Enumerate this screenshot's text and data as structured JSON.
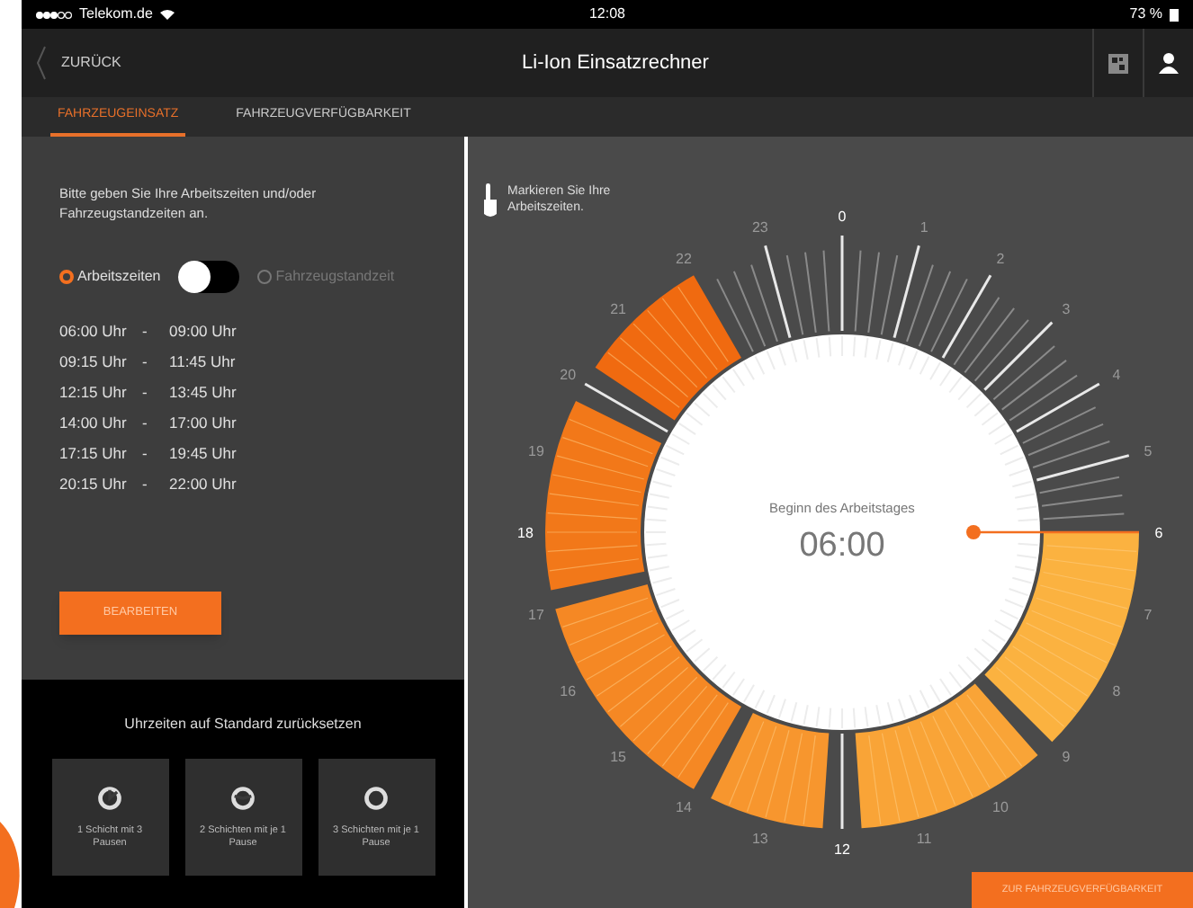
{
  "status_bar": {
    "carrier": "Telekom.de",
    "time": "12:08",
    "battery": "73 %"
  },
  "nav": {
    "back": "ZURÜCK",
    "title": "Li-Ion Einsatzrechner"
  },
  "tabs": [
    {
      "label": "FAHRZEUGEINSATZ",
      "selected": true
    },
    {
      "label": "FAHRZEUGVERFÜGBARKEIT",
      "selected": false
    }
  ],
  "left": {
    "instructions": "Bitte geben Sie Ihre Arbeitszeiten und/oder Fahrzeugstandzeiten an.",
    "modes": [
      {
        "label": "Arbeitszeiten",
        "selected": true
      },
      {
        "label": "Fahrzeugstandzeit",
        "selected": false
      }
    ],
    "toggle_on": false,
    "times": [
      {
        "start": "06:00 Uhr",
        "sep": "-",
        "end": "09:00 Uhr"
      },
      {
        "start": "09:15 Uhr",
        "sep": "-",
        "end": "11:45 Uhr"
      },
      {
        "start": "12:15 Uhr",
        "sep": "-",
        "end": "13:45 Uhr"
      },
      {
        "start": "14:00 Uhr",
        "sep": "-",
        "end": "17:00 Uhr"
      },
      {
        "start": "17:15 Uhr",
        "sep": "-",
        "end": "19:45 Uhr"
      },
      {
        "start": "20:15 Uhr",
        "sep": "-",
        "end": "22:00 Uhr"
      }
    ],
    "edit_button": "BEARBEITEN"
  },
  "reset": {
    "title": "Uhrzeiten auf Standard zurücksetzen",
    "presets": [
      {
        "kind": "one",
        "label": "1 Schicht mit 3 Pausen"
      },
      {
        "kind": "two",
        "label": "2 Schichten mit je 1 Pause"
      },
      {
        "kind": "three",
        "label": "3 Schichten mit je 1 Pause"
      }
    ]
  },
  "dial": {
    "hint": "Markieren Sie Ihre Arbeitszeiten.",
    "hour_labels": [
      "0",
      "1",
      "2",
      "3",
      "4",
      "5",
      "6",
      "7",
      "8",
      "9",
      "10",
      "11",
      "12",
      "13",
      "14",
      "15",
      "16",
      "17",
      "18",
      "19",
      "20",
      "21",
      "22",
      "23"
    ],
    "center_label": "Beginn des Arbeitstages",
    "start_time": "06:00"
  },
  "next_button": "ZUR FAHRZEUGVERFÜGBARKEIT"
}
